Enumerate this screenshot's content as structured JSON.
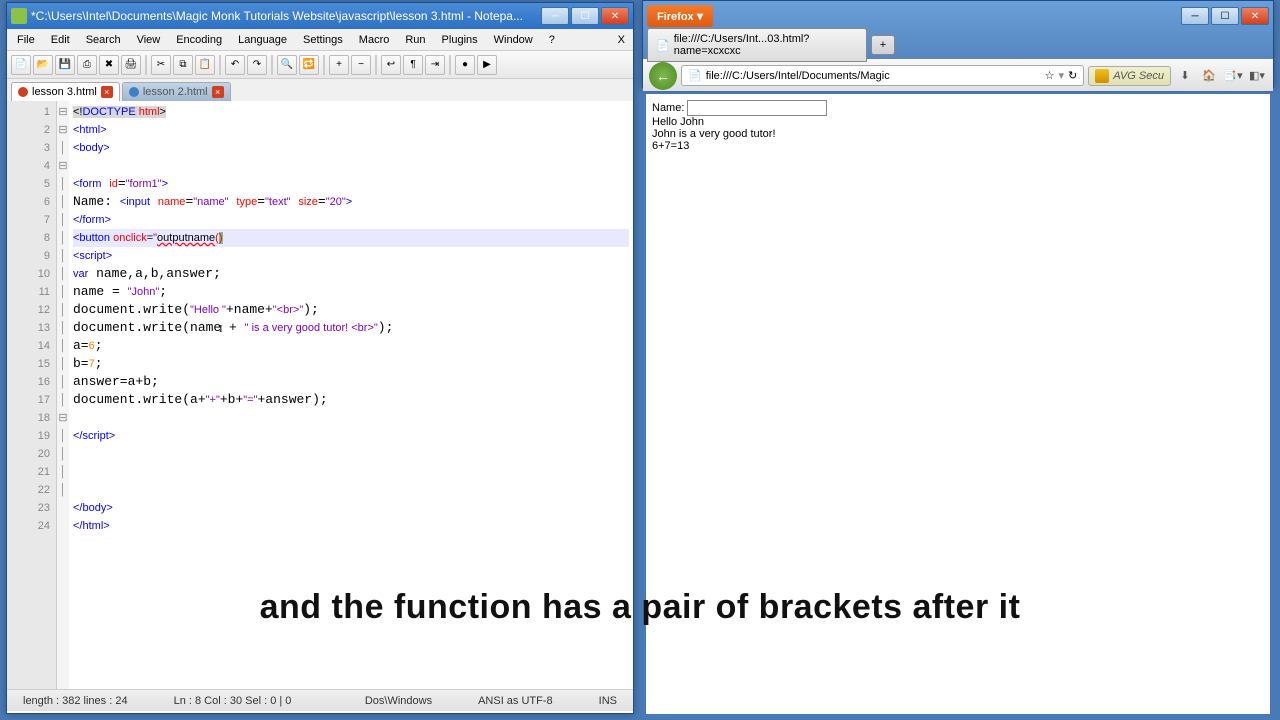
{
  "notepad": {
    "title": "*C:\\Users\\Intel\\Documents\\Magic Monk Tutorials Website\\javascript\\lesson 3.html - Notepa...",
    "menus": [
      "File",
      "Edit",
      "Search",
      "View",
      "Encoding",
      "Language",
      "Settings",
      "Macro",
      "Run",
      "Plugins",
      "Window",
      "?"
    ],
    "tabs": [
      {
        "label": "lesson 3.html",
        "active": true
      },
      {
        "label": "lesson 2.html",
        "active": false
      }
    ],
    "status": {
      "length": "length : 382   lines : 24",
      "pos": "Ln : 8   Col : 30   Sel : 0 | 0",
      "eol": "Dos\\Windows",
      "enc": "ANSI as UTF-8",
      "mode": "INS"
    }
  },
  "code": {
    "lines": 24
  },
  "firefox": {
    "menu": "Firefox",
    "tab": "file:///C:/Users/Int...03.html?name=xcxcxc",
    "url": "file:///C:/Users/Intel/Documents/Magic",
    "avg": "AVG Secu",
    "page": {
      "label": "Name:",
      "l1": "Hello John",
      "l2": "John is a very good tutor!",
      "l3": "6+7=13"
    }
  },
  "caption": "and the function has a pair of brackets after it"
}
